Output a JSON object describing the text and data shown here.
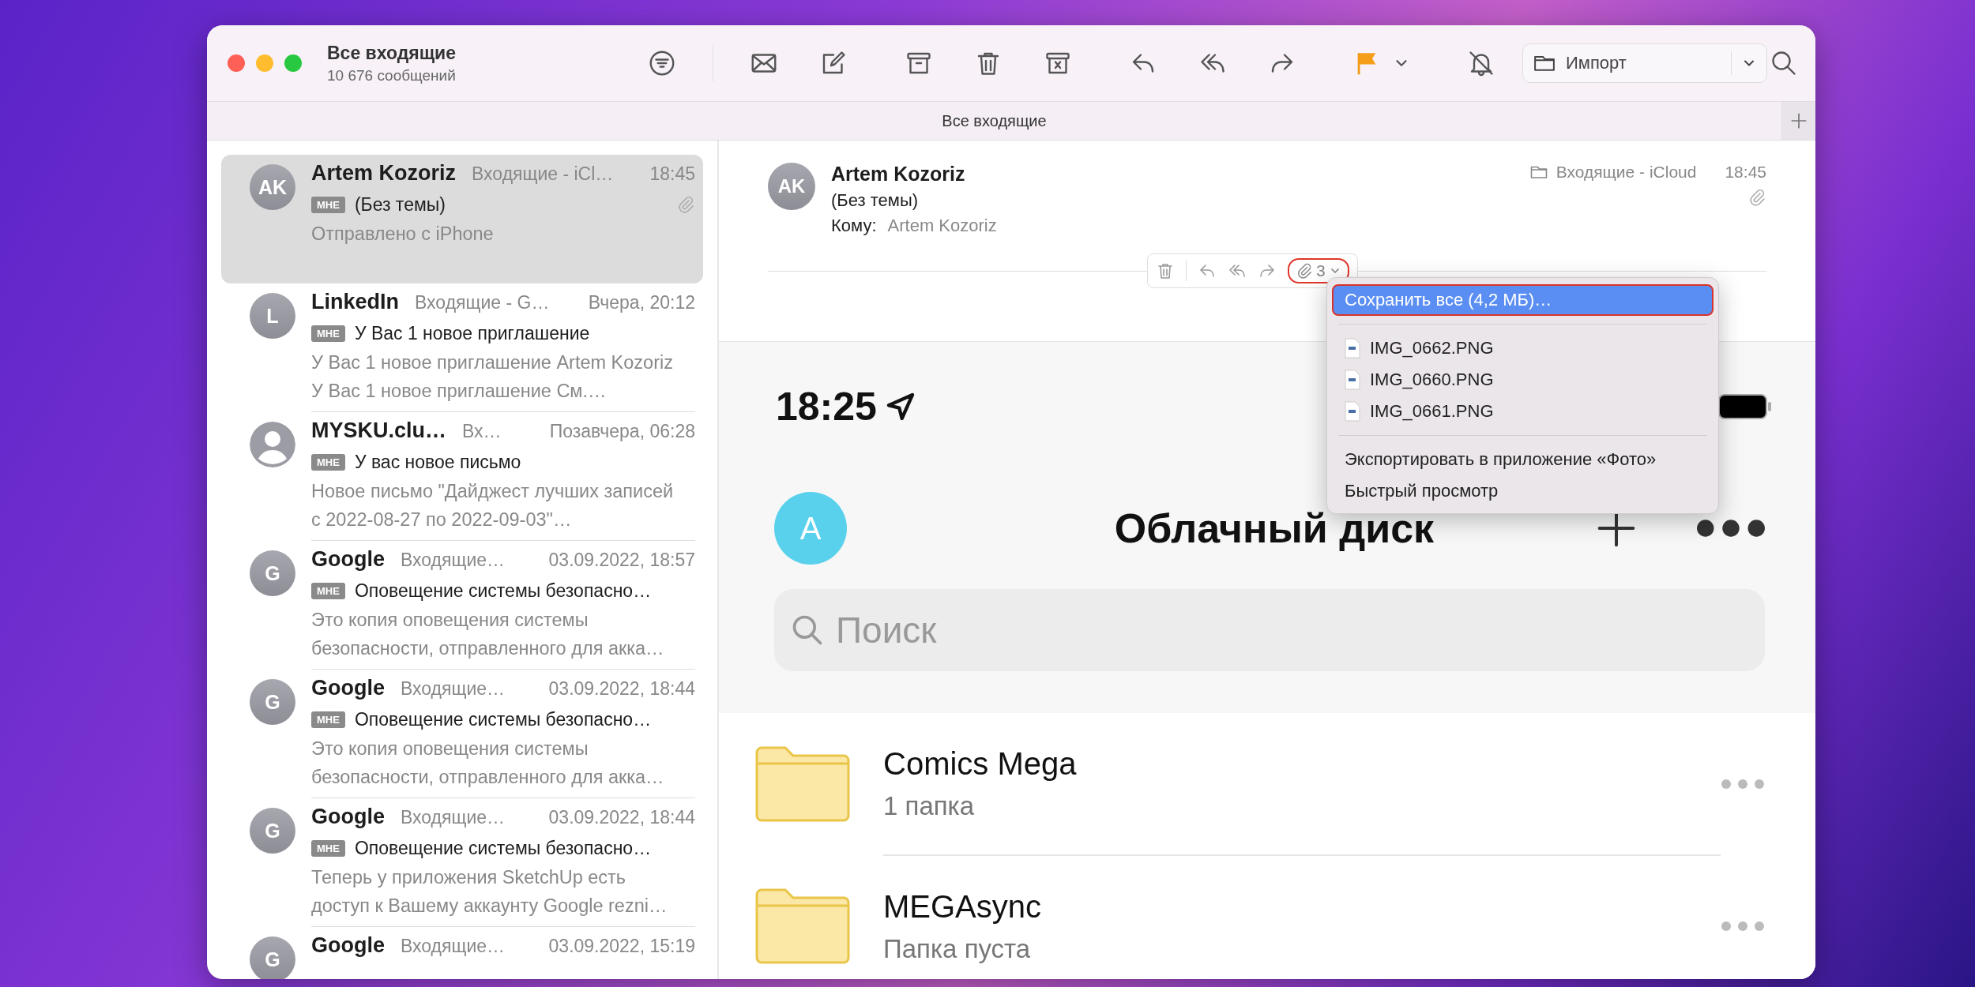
{
  "window": {
    "title": "Все входящие",
    "subtitle": "10 676 сообщений"
  },
  "toolbar": {
    "mailbox_popup": "Импорт"
  },
  "tab_bar": {
    "title": "Все входящие"
  },
  "messages": [
    {
      "initials": "AK",
      "sender": "Artem Kozoriz",
      "mailbox": "Входящие - iCl…",
      "time": "18:45",
      "badge": "МНЕ",
      "subject": "(Без темы)",
      "preview": "Отправлено с iPhone",
      "attachment": true,
      "selected": true
    },
    {
      "initials": "L",
      "sender": "LinkedIn",
      "mailbox": "Входящие - G…",
      "time": "Вчера, 20:12",
      "badge": "МНЕ",
      "subject": "У Вас 1 новое приглашение",
      "preview": "У Вас 1 новое приглашение Artem Kozoriz У Вас 1 новое приглашение См.…",
      "attachment": false,
      "selected": false
    },
    {
      "sender": "MYSKU.clu…",
      "mailbox": "Вх…",
      "time": "Позавчера, 06:28",
      "badge": "МНЕ",
      "subject": "У вас новое письмо",
      "preview": "Новое письмо \"Дайджест лучших записей с 2022-08-27 по 2022-09-03\"…",
      "attachment": false,
      "selected": false
    },
    {
      "initials": "G",
      "sender": "Google",
      "mailbox": "Входящие…",
      "time": "03.09.2022, 18:57",
      "badge": "МНЕ",
      "subject": "Оповещение системы безопасно…",
      "preview": "Это копия оповещения системы безопасности, отправленного для акка…",
      "attachment": false,
      "selected": false
    },
    {
      "initials": "G",
      "sender": "Google",
      "mailbox": "Входящие…",
      "time": "03.09.2022, 18:44",
      "badge": "МНЕ",
      "subject": "Оповещение системы безопасно…",
      "preview": "Это копия оповещения системы безопасности, отправленного для акка…",
      "attachment": false,
      "selected": false
    },
    {
      "initials": "G",
      "sender": "Google",
      "mailbox": "Входящие…",
      "time": "03.09.2022, 18:44",
      "badge": "МНЕ",
      "subject": "Оповещение системы безопасно…",
      "preview": "Теперь у приложения SketchUp есть доступ к Вашему аккаунту Google rezni…",
      "attachment": false,
      "selected": false
    },
    {
      "initials": "G",
      "sender": "Google",
      "mailbox": "Входящие…",
      "time": "03.09.2022, 15:19",
      "attachment": false,
      "selected": false
    }
  ],
  "reader": {
    "initials": "AK",
    "sender": "Artem Kozoriz",
    "subject": "(Без темы)",
    "to_label": "Кому:",
    "to": "Artem Kozoriz",
    "mailbox": "Входящие - iCloud",
    "time": "18:45",
    "attachment": true,
    "attachment_button": {
      "count": "3",
      "highlighted": true
    }
  },
  "attachment_menu": {
    "items": [
      {
        "kind": "action",
        "label": "Сохранить все (4,2 МБ)…",
        "selected": true,
        "highlighted": true
      },
      {
        "kind": "separator"
      },
      {
        "kind": "file",
        "label": "IMG_0662.PNG",
        "selected": false,
        "highlighted": false
      },
      {
        "kind": "file",
        "label": "IMG_0660.PNG",
        "selected": false,
        "highlighted": false
      },
      {
        "kind": "file",
        "label": "IMG_0661.PNG",
        "selected": false,
        "highlighted": false
      },
      {
        "kind": "separator"
      },
      {
        "kind": "action",
        "label": "Экспортировать в приложение «Фото»",
        "selected": false,
        "highlighted": false
      },
      {
        "kind": "action",
        "label": "Быстрый просмотр",
        "selected": false,
        "highlighted": false
      }
    ]
  },
  "phone_screenshot": {
    "time": "18:25",
    "avatar": "A",
    "title": "Облачный диск",
    "search_placeholder": "Поиск",
    "folders": [
      {
        "name": "Comics Mega",
        "detail": "1 папка"
      },
      {
        "name": "MEGAsync",
        "detail": "Папка пуста"
      }
    ]
  }
}
